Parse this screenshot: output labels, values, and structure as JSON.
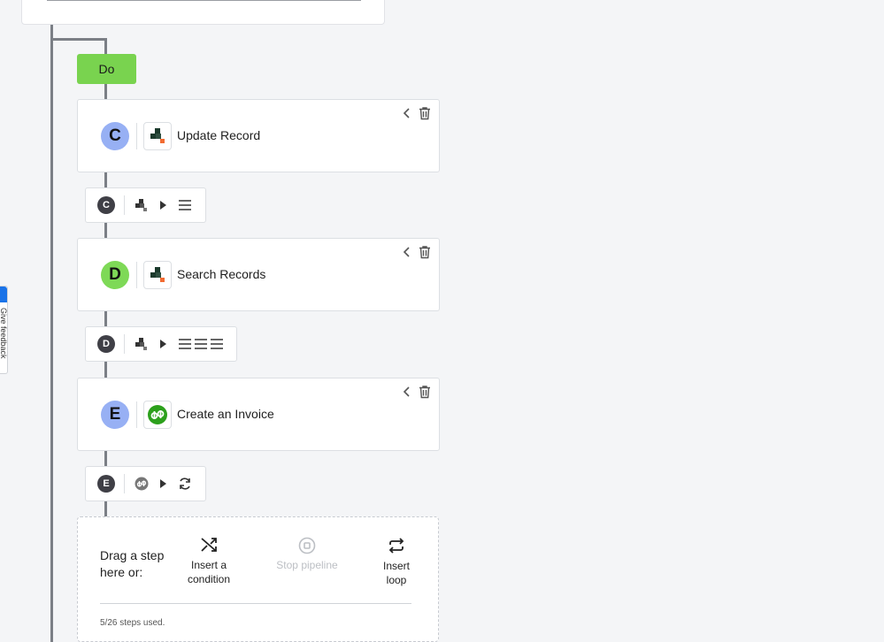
{
  "do_label": "Do",
  "steps": [
    {
      "letter": "C",
      "letter_color": "#97b0f4",
      "title": "Update Record",
      "app_icon": "airtable-icon"
    },
    {
      "letter": "D",
      "letter_color": "#7ed957",
      "title": "Search Records",
      "app_icon": "airtable-icon"
    },
    {
      "letter": "E",
      "letter_color": "#97b0f4",
      "title": "Create an Invoice",
      "app_icon": "quickbooks-icon"
    }
  ],
  "mini_steps": [
    {
      "letter": "C",
      "app_icon": "airtable-icon",
      "tail_icon": "list-icon"
    },
    {
      "letter": "D",
      "app_icon": "airtable-icon",
      "tail_icon": "list-triple-icon"
    },
    {
      "letter": "E",
      "app_icon": "quickbooks-icon",
      "tail_icon": "refresh-icon"
    }
  ],
  "add_zone": {
    "prompt": "Drag a step here or:",
    "actions": [
      {
        "label": "Insert a condition",
        "icon": "shuffle-icon",
        "enabled": true
      },
      {
        "label": "Stop pipeline",
        "icon": "stop-circle-icon",
        "enabled": false
      },
      {
        "label": "Insert loop",
        "icon": "loop-icon",
        "enabled": true
      }
    ],
    "steps_used": "5/26 steps used."
  },
  "feedback_label": "Give feedback",
  "colors": {
    "do_button": "#79d34f",
    "connector": "#7b7f86",
    "quickbooks_green": "#2ca01c",
    "badge_dark": "#3f3f46"
  }
}
